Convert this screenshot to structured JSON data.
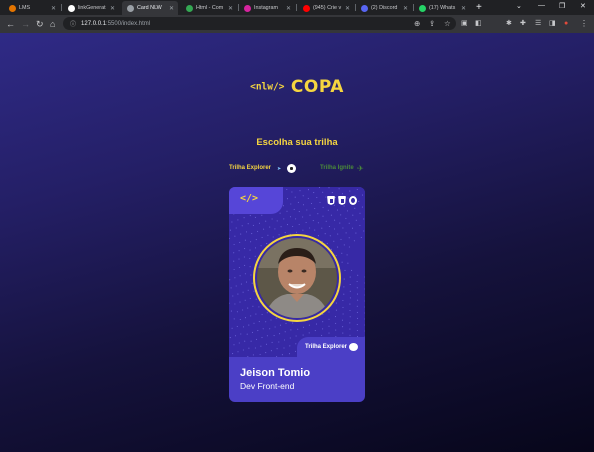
{
  "browser": {
    "tabs": [
      {
        "label": "LMS",
        "favicon": "lms-icon",
        "color": "#e37400",
        "active": false
      },
      {
        "label": "linkGenerat",
        "favicon": "github-icon",
        "color": "#ffffff",
        "active": false
      },
      {
        "label": "Card NLW",
        "favicon": "globe-icon",
        "color": "#9aa0a6",
        "active": true
      },
      {
        "label": "Html - Com",
        "favicon": "notes-icon",
        "color": "#34a853",
        "active": false
      },
      {
        "label": "Instagram",
        "favicon": "instagram-icon",
        "color": "#d6249f",
        "active": false
      },
      {
        "label": "(945) Crie v",
        "favicon": "youtube-icon",
        "color": "#ff0000",
        "active": false
      },
      {
        "label": "(2) Discord",
        "favicon": "discord-icon",
        "color": "#5865f2",
        "active": false
      },
      {
        "label": "(17) Whats",
        "favicon": "whatsapp-icon",
        "color": "#25d366",
        "active": false
      }
    ],
    "url_host": "127.0.0.1",
    "url_rest": ":5500/index.html"
  },
  "page": {
    "logo_nlw": "<nlw/>",
    "logo_copa": "COPA",
    "heading": "Escolha sua trilha",
    "trail_explorer": "Trilha Explorer",
    "trail_ignite": "Trilha Ignite"
  },
  "card": {
    "code_symbol": "</>",
    "tag": "Trilha Explorer",
    "name": "Jeison Tomio",
    "role": "Dev Front-end"
  },
  "colors": {
    "accent": "#f5d540",
    "card": "#3729a6",
    "card_bottom": "#4b3fc6",
    "ignite": "#4a8a3a"
  }
}
